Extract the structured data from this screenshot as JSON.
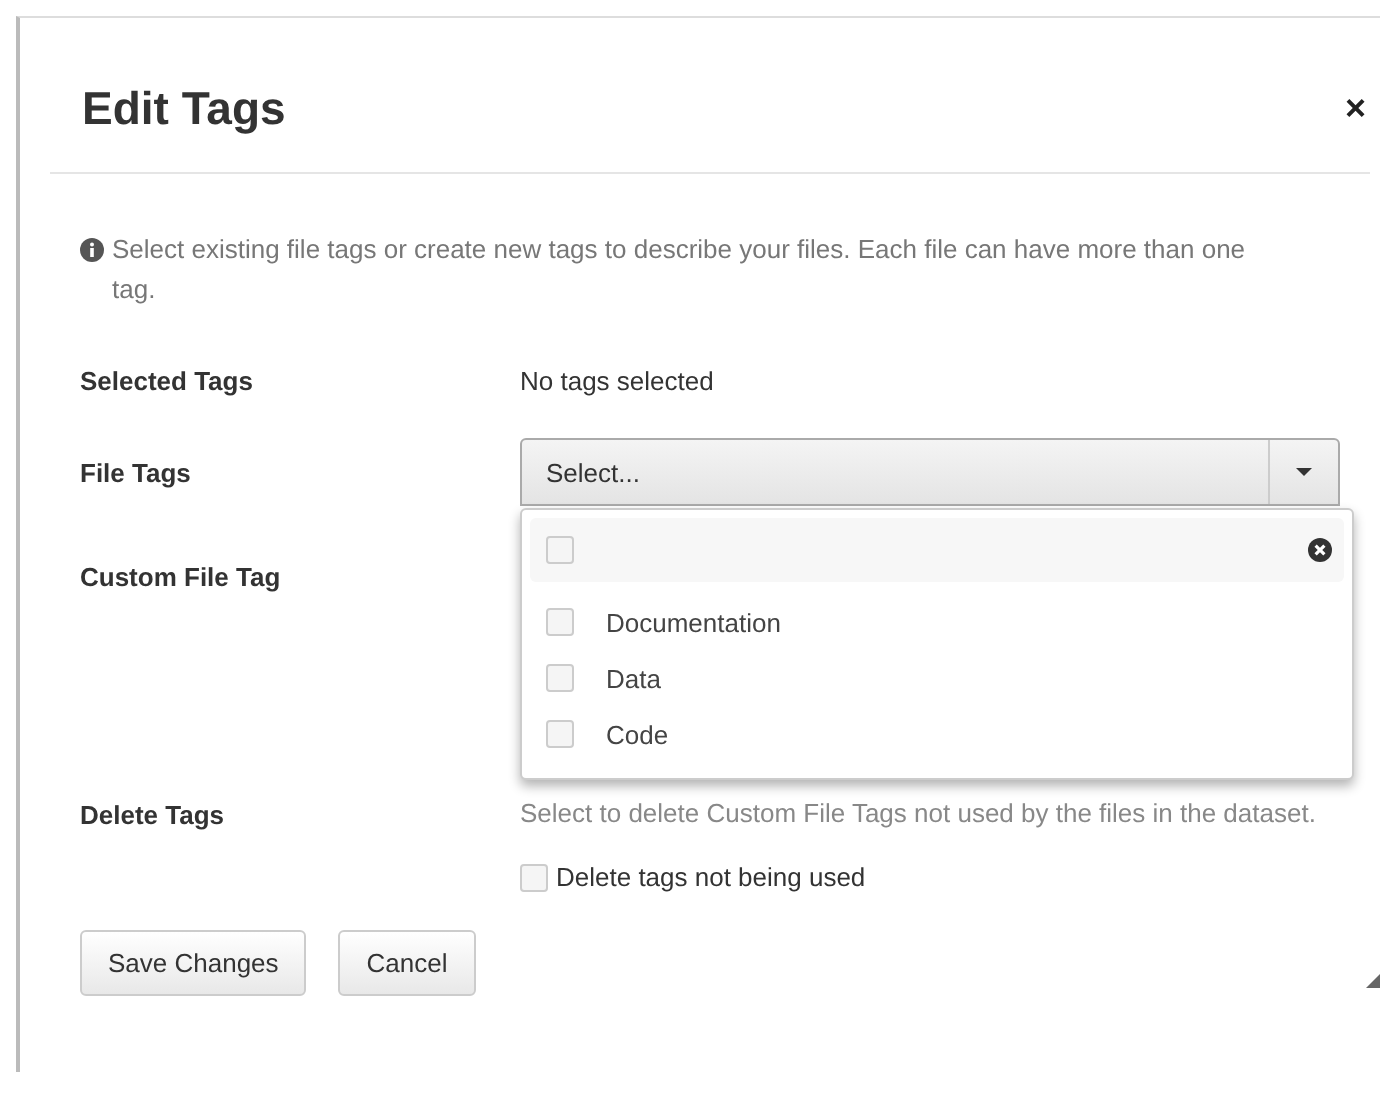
{
  "dialog": {
    "title": "Edit Tags",
    "close": "×"
  },
  "info": "Select existing file tags or create new tags to describe your files. Each file can have more than one tag.",
  "selected_tags": {
    "label": "Selected Tags",
    "value": "No tags selected"
  },
  "file_tags": {
    "label": "File Tags",
    "placeholder": "Select...",
    "expanded": true,
    "dropdown": {
      "search_checked": false,
      "options": [
        {
          "label": "Documentation",
          "checked": false
        },
        {
          "label": "Data",
          "checked": false
        },
        {
          "label": "Code",
          "checked": false
        }
      ]
    }
  },
  "custom_file_tag": {
    "label": "Custom File Tag"
  },
  "delete_tags": {
    "label": "Delete Tags",
    "description": "Select to delete Custom File Tags not used by the files in the dataset.",
    "checkbox": {
      "label": "Delete tags not being used",
      "checked": false
    }
  },
  "buttons": [
    "Save Changes",
    "Cancel"
  ]
}
